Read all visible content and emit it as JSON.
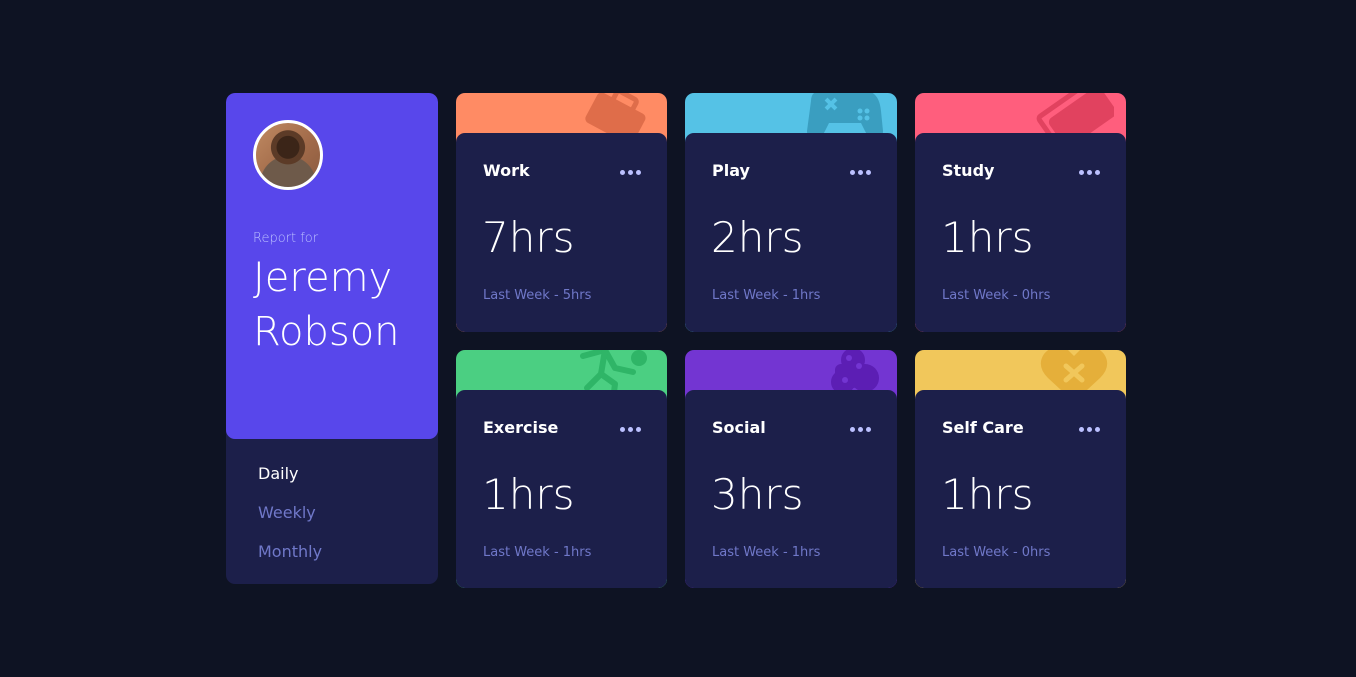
{
  "profile": {
    "report_label": "Report for",
    "name": "Jeremy Robson",
    "timeframes": [
      "Daily",
      "Weekly",
      "Monthly"
    ],
    "active_timeframe": "Daily"
  },
  "activities": [
    {
      "title": "Work",
      "hours": "7hrs",
      "previous": "Last Week - 5hrs",
      "color": "#ff8b64",
      "icon": "briefcase-icon"
    },
    {
      "title": "Play",
      "hours": "2hrs",
      "previous": "Last Week - 1hrs",
      "color": "#55c2e6",
      "icon": "gamepad-icon"
    },
    {
      "title": "Study",
      "hours": "1hrs",
      "previous": "Last Week - 0hrs",
      "color": "#ff5e7d",
      "icon": "books-icon"
    },
    {
      "title": "Exercise",
      "hours": "1hrs",
      "previous": "Last Week - 1hrs",
      "color": "#4bcf82",
      "icon": "running-icon"
    },
    {
      "title": "Social",
      "hours": "3hrs",
      "previous": "Last Week - 1hrs",
      "color": "#7335d2",
      "icon": "social-icon"
    },
    {
      "title": "Self Care",
      "hours": "1hrs",
      "previous": "Last Week - 0hrs",
      "color": "#f1c75b",
      "icon": "heart-icon"
    }
  ],
  "colors": {
    "page_bg": "#0e1323",
    "card_bg": "#1c1f4a",
    "profile_bg": "#5847eb",
    "muted_text": "#7078c9",
    "pale_text": "#bbc0ff"
  }
}
